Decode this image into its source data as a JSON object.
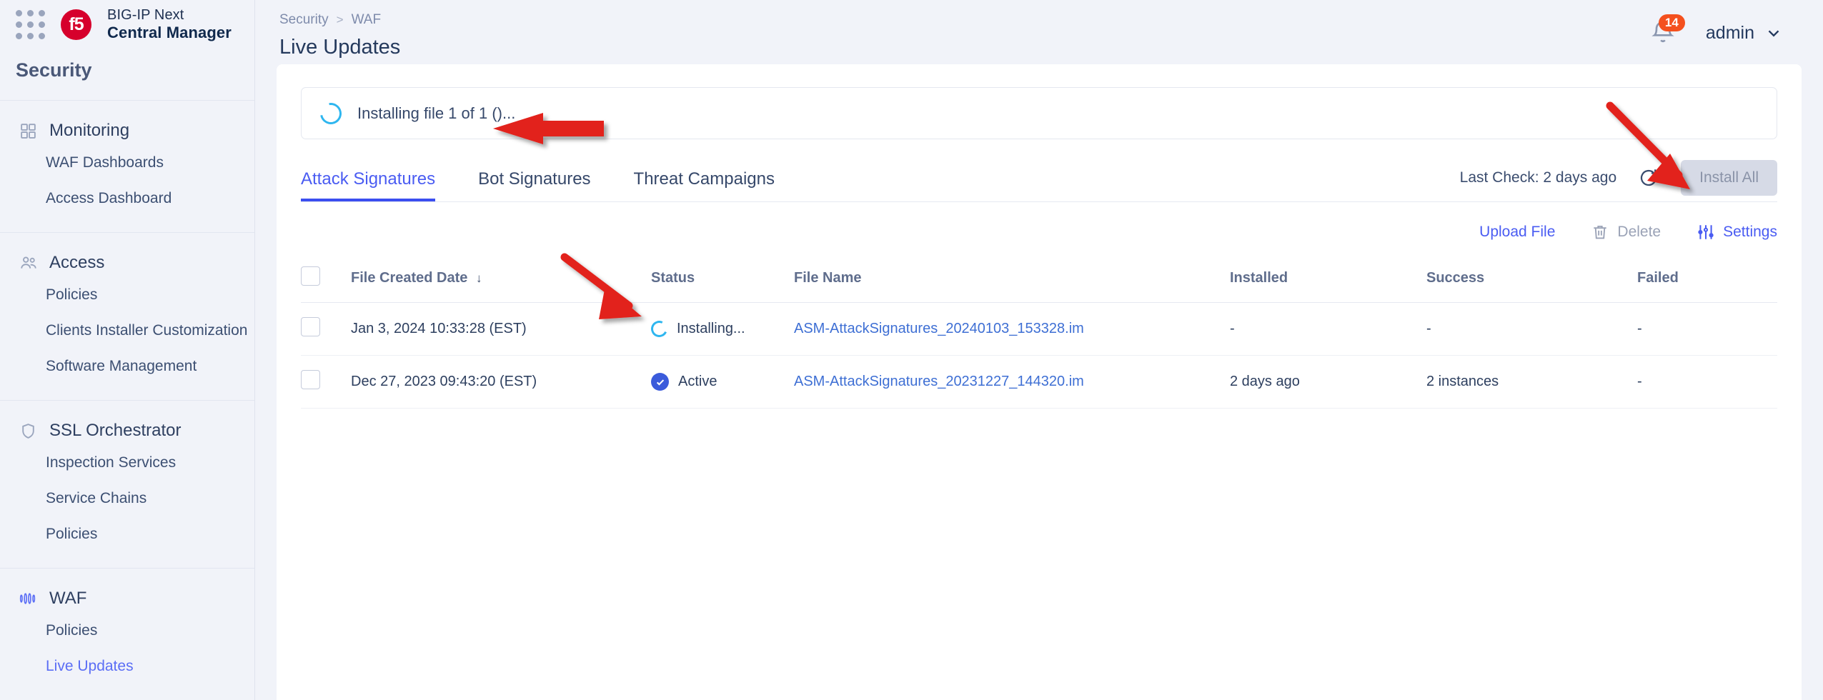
{
  "brand": {
    "logo_text": "f5",
    "line1": "BIG-IP Next",
    "line2": "Central Manager",
    "grid_icon": "app-grid-icon"
  },
  "sidebar": {
    "section_title": "Security",
    "groups": [
      {
        "label": "Monitoring",
        "icon": "dashboard-grid-icon",
        "items": [
          {
            "label": "WAF Dashboards",
            "active": false
          },
          {
            "label": "Access Dashboard",
            "active": false
          }
        ]
      },
      {
        "label": "Access",
        "icon": "users-icon",
        "items": [
          {
            "label": "Policies",
            "active": false
          },
          {
            "label": "Clients Installer Customization",
            "active": false
          },
          {
            "label": "Software Management",
            "active": false
          }
        ]
      },
      {
        "label": "SSL Orchestrator",
        "icon": "shield-icon",
        "items": [
          {
            "label": "Inspection Services",
            "active": false
          },
          {
            "label": "Service Chains",
            "active": false
          },
          {
            "label": "Policies",
            "active": false
          }
        ]
      },
      {
        "label": "WAF",
        "icon": "waf-icon",
        "items": [
          {
            "label": "Policies",
            "active": false
          },
          {
            "label": "Live Updates",
            "active": true
          }
        ]
      }
    ]
  },
  "header": {
    "breadcrumb": {
      "parent": "Security",
      "separator": ">",
      "current": "WAF"
    },
    "page_title": "Live Updates",
    "notifications": {
      "icon": "bell-icon",
      "count": "14",
      "badge_color": "#f4501e"
    },
    "user": {
      "name": "admin",
      "chevron": "chevron-down-icon"
    }
  },
  "banner": {
    "icon": "loading-spinner-icon",
    "message": "Installing file 1 of 1 ()..."
  },
  "tabs": [
    {
      "label": "Attack Signatures",
      "active": true
    },
    {
      "label": "Bot Signatures",
      "active": false
    },
    {
      "label": "Threat Campaigns",
      "active": false
    }
  ],
  "tabs_right": {
    "last_check": "Last Check: 2 days ago",
    "refresh_icon": "refresh-icon",
    "install_all_label": "Install All",
    "install_all_disabled": true
  },
  "actions": [
    {
      "label": "Upload File",
      "icon": null,
      "state": "link"
    },
    {
      "label": "Delete",
      "icon": "trash-icon",
      "state": "disabled"
    },
    {
      "label": "Settings",
      "icon": "sliders-icon",
      "state": "link"
    }
  ],
  "table": {
    "columns": [
      "File Created Date",
      "Status",
      "File Name",
      "Installed",
      "Success",
      "Failed"
    ],
    "sorted_column": "File Created Date",
    "sort_direction": "desc",
    "rows": [
      {
        "selected": false,
        "date": "Jan 3, 2024 10:33:28 (EST)",
        "status": "Installing...",
        "status_icon": "loading-spinner-icon",
        "file_name": "ASM-AttackSignatures_20240103_153328.im",
        "installed": "-",
        "success": "-",
        "failed": "-"
      },
      {
        "selected": false,
        "date": "Dec 27, 2023 09:43:20 (EST)",
        "status": "Active",
        "status_icon": "check-circle-icon",
        "file_name": "ASM-AttackSignatures_20231227_144320.im",
        "installed": "2 days ago",
        "success": "2 instances",
        "failed": "-"
      }
    ]
  },
  "annotations": {
    "color": "#e2231a",
    "arrows": [
      {
        "name": "arrow-to-installing-banner"
      },
      {
        "name": "arrow-to-refresh-icon"
      },
      {
        "name": "arrow-to-installing-status"
      }
    ]
  },
  "colors": {
    "accent_blue": "#4a5cf2",
    "link_blue": "#3e6fd4",
    "brand_red": "#d6002c",
    "spinner_cyan": "#2eb6ef",
    "status_active": "#3b5bdb"
  }
}
